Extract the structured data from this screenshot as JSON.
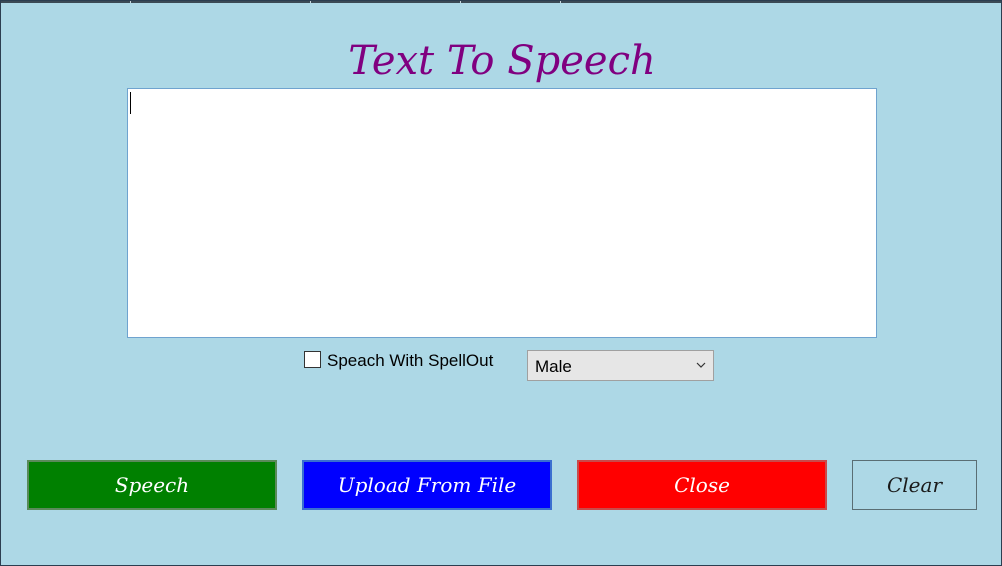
{
  "app": {
    "title": "Text To Speech",
    "background": "#add8e6",
    "title_color": "#800080"
  },
  "editor": {
    "value": ""
  },
  "options": {
    "spellout_label": "Speach With SpellOut",
    "spellout_checked": false,
    "voice_selected": "Male"
  },
  "buttons": {
    "speech": {
      "label": "Speech",
      "color": "#008000"
    },
    "upload": {
      "label": "Upload From File",
      "color": "#0000ff"
    },
    "close": {
      "label": "Close",
      "color": "#ff0000"
    },
    "clear": {
      "label": "Clear"
    }
  }
}
